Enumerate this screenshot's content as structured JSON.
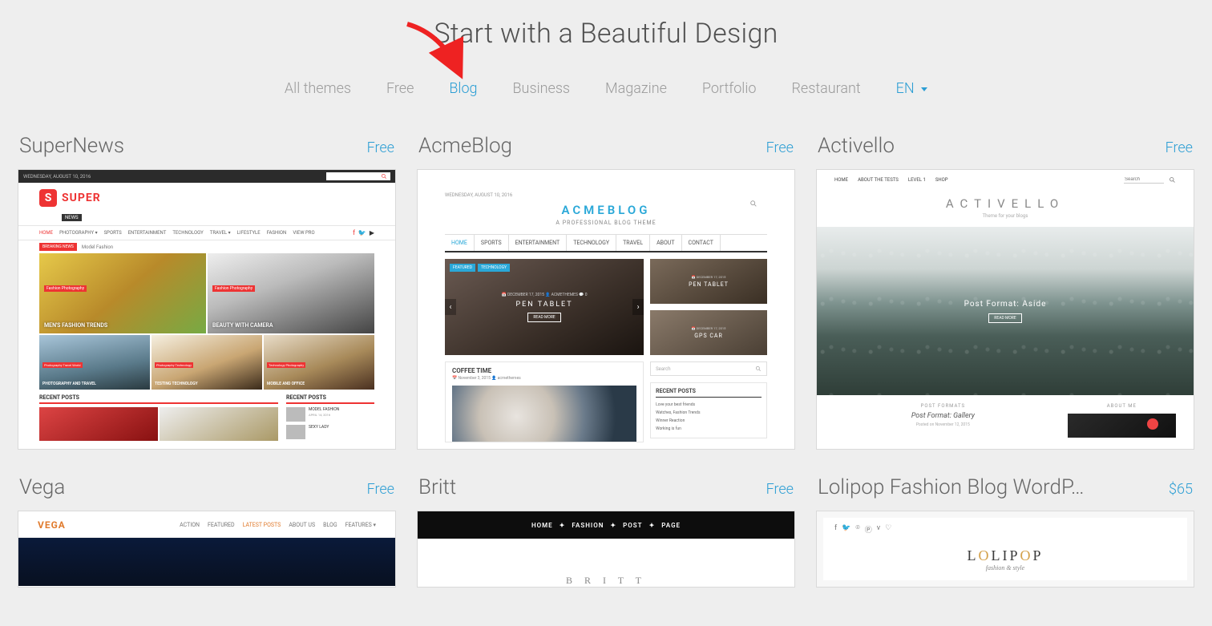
{
  "page_title": "Start with a Beautiful Design",
  "filters": {
    "items": [
      {
        "label": "All themes",
        "active": false
      },
      {
        "label": "Free",
        "active": false
      },
      {
        "label": "Blog",
        "active": true
      },
      {
        "label": "Business",
        "active": false
      },
      {
        "label": "Magazine",
        "active": false
      },
      {
        "label": "Portfolio",
        "active": false
      },
      {
        "label": "Restaurant",
        "active": false
      }
    ],
    "language": "EN"
  },
  "themes": [
    {
      "title": "SuperNews",
      "price": "Free",
      "preview": {
        "topbar_date": "WEDNESDAY, AUGUST 10, 2016",
        "search_placeholder": "Search",
        "logo_text": "SUPER",
        "logo_sub": "NEWS",
        "nav": [
          "HOME",
          "PHOTOGRAPHY ▾",
          "SPORTS",
          "ENTERTAINMENT",
          "TECHNOLOGY",
          "TRAVEL ▾",
          "LIFESTYLE",
          "FASHION",
          "VIEW PRO"
        ],
        "breaking_label": "BREAKING NEWS",
        "breaking_text": "Model Fashion",
        "hero": [
          {
            "tag": "Fashion  Photography",
            "title": "MEN'S FASHION TRENDS"
          },
          {
            "tag": "Fashion  Photography",
            "title": "BEAUTY WITH CAMERA"
          }
        ],
        "row3": [
          {
            "tag": "Photography  Travel  World",
            "title": "PHOTOGRAPHY AND TRAVEL"
          },
          {
            "tag": "Photography  Technology",
            "title": "TESTING TECHNOLOGY"
          },
          {
            "tag": "Technology  Photography",
            "title": "MOBILE AND OFFICE"
          }
        ],
        "recent_header": "RECENT POSTS",
        "side_posts": [
          {
            "title": "MODEL FASHION",
            "meta": "APRIL 14, 2016"
          },
          {
            "title": "SEXY LADY",
            "meta": ""
          }
        ]
      }
    },
    {
      "title": "AcmeBlog",
      "price": "Free",
      "preview": {
        "date": "WEDNESDAY, AUGUST 10, 2016",
        "logo": "ACMEBLOG",
        "tagline": "A PROFESSIONAL BLOG THEME",
        "nav": [
          "HOME",
          "SPORTS",
          "ENTERTAINMENT",
          "TECHNOLOGY",
          "TRAVEL",
          "ABOUT",
          "CONTACT"
        ],
        "slide": {
          "tags": [
            "FEATURED",
            "TECHNOLOGY"
          ],
          "meta": "📅 DECEMBER 17, 2015   👤 ACMETHEMES   💬 0",
          "title": "PEN TABLET",
          "button": "READ MORE"
        },
        "side_tiles": [
          {
            "date": "📅 DECEMBER 17, 2015",
            "title": "PEN TABLET"
          },
          {
            "date": "📅 DECEMBER 17, 2015",
            "title": "GPS CAR"
          }
        ],
        "post": {
          "title": "COFFEE TIME",
          "meta": "📅 November 3, 2015   👤 acmethemes"
        },
        "search_placeholder": "Search",
        "recent_header": "RECENT POSTS",
        "recent_items": [
          "Love your best friends",
          "Watches, Fashion Trends",
          "Winner Reaction",
          "Working is fun"
        ]
      }
    },
    {
      "title": "Activello",
      "price": "Free",
      "preview": {
        "nav": [
          "HOME",
          "ABOUT THE TESTS",
          "LEVEL 1",
          "SHOP"
        ],
        "search_placeholder": "Search",
        "logo": "ACTIVELLO",
        "tagline": "Theme for your blogs",
        "hero_title": "Post Format: Aside",
        "hero_button": "READ MORE",
        "post_formats_label": "POST FORMATS",
        "post_title": "Post Format: Gallery",
        "post_date": "Posted on November 12, 2015",
        "about_label": "ABOUT ME"
      }
    },
    {
      "title": "Vega",
      "price": "Free",
      "preview": {
        "logo": "VEGA",
        "nav": [
          "ACTION",
          "FEATURED",
          "LATEST POSTS",
          "ABOUT US",
          "BLOG",
          "FEATURES ▾"
        ],
        "nav_active_index": 2
      }
    },
    {
      "title": "Britt",
      "price": "Free",
      "preview": {
        "nav": [
          "HOME",
          "FASHION",
          "POST",
          "PAGE"
        ],
        "logo": "B R I T T"
      }
    },
    {
      "title": "Lolipop Fashion Blog WordP…",
      "price": "$65",
      "preview": {
        "logo_main": "LOLIPOP",
        "logo_sub": "fashion & style"
      }
    }
  ]
}
